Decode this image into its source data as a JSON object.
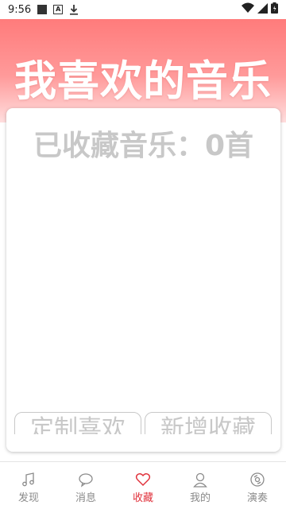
{
  "status": {
    "time": "9:56",
    "notif_a": "A"
  },
  "header": {
    "title": "我喜欢的音乐"
  },
  "card": {
    "count_text": "已收藏音乐：0首",
    "buttons": [
      "定制喜欢",
      "新增收藏"
    ]
  },
  "nav": {
    "items": [
      {
        "label": "发现",
        "icon": "music-note-icon",
        "active": false
      },
      {
        "label": "消息",
        "icon": "chat-bubble-icon",
        "active": false
      },
      {
        "label": "收藏",
        "icon": "heart-icon",
        "active": true
      },
      {
        "label": "我的",
        "icon": "person-icon",
        "active": false
      },
      {
        "label": "演奏",
        "icon": "disc-icon",
        "active": false
      }
    ]
  },
  "colors": {
    "accent": "#e0303a",
    "header_top": "#ff7b7b",
    "header_bottom": "#ffdede",
    "muted_text": "#c8c8c8",
    "nav_text": "#8a8a8a"
  }
}
